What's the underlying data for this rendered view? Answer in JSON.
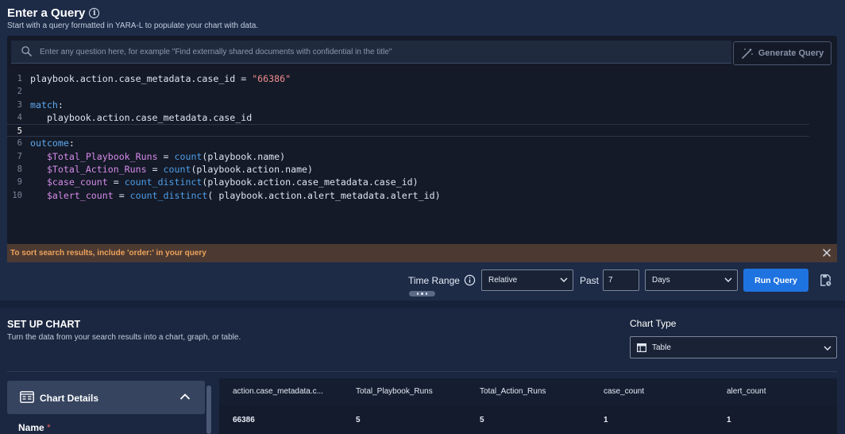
{
  "query": {
    "title": "Enter a Query",
    "info_glyph": "i",
    "subtitle": "Start with a query formatted in YARA-L to populate your chart with data.",
    "search_placeholder": "Enter any question here, for example \"Find externally shared documents with confidential in the title\"",
    "generate_button": "Generate Query",
    "code_lines": [
      {
        "num": "1",
        "parts": [
          {
            "t": "playbook.action.case_metadata.case_id = ",
            "c": ""
          },
          {
            "t": "\"66386\"",
            "c": "str"
          }
        ]
      },
      {
        "num": "2",
        "parts": []
      },
      {
        "num": "3",
        "parts": [
          {
            "t": "match",
            "c": "kw"
          },
          {
            "t": ":",
            "c": ""
          }
        ]
      },
      {
        "num": "4",
        "parts": [
          {
            "t": "   playbook.action.case_metadata.case_id",
            "c": ""
          }
        ]
      },
      {
        "num": "5",
        "parts": [],
        "active": true
      },
      {
        "num": "6",
        "parts": [
          {
            "t": "outcome",
            "c": "kw"
          },
          {
            "t": ":",
            "c": ""
          }
        ]
      },
      {
        "num": "7",
        "parts": [
          {
            "t": "   ",
            "c": ""
          },
          {
            "t": "$Total_Playbook_Runs",
            "c": "var"
          },
          {
            "t": " = ",
            "c": ""
          },
          {
            "t": "count",
            "c": "fn"
          },
          {
            "t": "(playbook.name)",
            "c": ""
          }
        ]
      },
      {
        "num": "8",
        "parts": [
          {
            "t": "   ",
            "c": ""
          },
          {
            "t": "$Total_Action_Runs",
            "c": "var"
          },
          {
            "t": " = ",
            "c": ""
          },
          {
            "t": "count",
            "c": "fn"
          },
          {
            "t": "(playbook.action.name)",
            "c": ""
          }
        ]
      },
      {
        "num": "9",
        "parts": [
          {
            "t": "   ",
            "c": ""
          },
          {
            "t": "$case_count",
            "c": "var"
          },
          {
            "t": " = ",
            "c": ""
          },
          {
            "t": "count_distinct",
            "c": "fn"
          },
          {
            "t": "(playbook.action.case_metadata.case_id)",
            "c": ""
          }
        ]
      },
      {
        "num": "10",
        "parts": [
          {
            "t": "   ",
            "c": ""
          },
          {
            "t": "$alert_count",
            "c": "var"
          },
          {
            "t": " = ",
            "c": ""
          },
          {
            "t": "count_distinct",
            "c": "fn"
          },
          {
            "t": "( playbook.action.alert_metadata.alert_id)",
            "c": ""
          }
        ]
      }
    ],
    "hint": "To sort search results, include 'order:' in your query",
    "time_range_label": "Time Range",
    "relative_value": "Relative",
    "past_label": "Past",
    "past_value": "7",
    "unit_value": "Days",
    "run_button": "Run Query"
  },
  "setup": {
    "title": "SET UP CHART",
    "subtitle": "Turn the data from your search results into a chart, graph, or table.",
    "chart_type_label": "Chart Type",
    "chart_type_value": "Table",
    "details_title": "Chart Details",
    "name_label": "Name",
    "required_mark": "*"
  },
  "results": {
    "columns": [
      "action.case_metadata.c...",
      "Total_Playbook_Runs",
      "Total_Action_Runs",
      "case_count",
      "alert_count"
    ],
    "rows": [
      [
        "66386",
        "5",
        "5",
        "1",
        "1"
      ]
    ]
  },
  "colors": {
    "accent": "#1f73e0",
    "hint_text": "#eda25b",
    "keyword": "#5ea8f0",
    "variable": "#d58bea",
    "string": "#f08c8c"
  },
  "icons": [
    "search-icon",
    "magic-wand-icon",
    "close-icon",
    "info-icon",
    "chevron-down-icon",
    "save-search-icon",
    "table-icon",
    "chart-details-icon",
    "chevron-up-icon"
  ]
}
